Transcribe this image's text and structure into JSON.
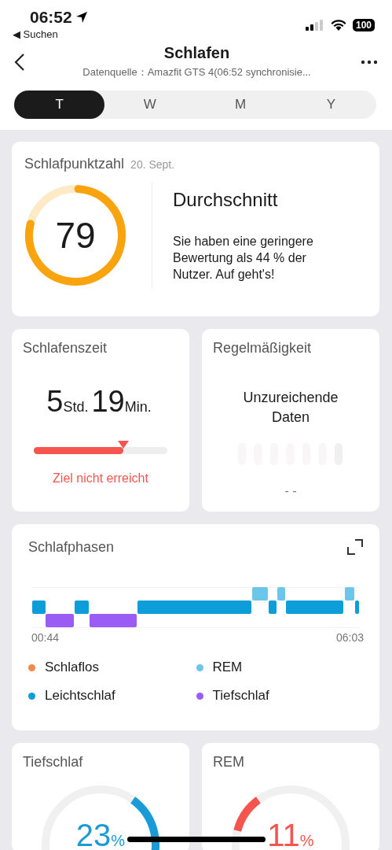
{
  "status_bar": {
    "time": "06:52",
    "back_link": "◀ Suchen",
    "battery": "100"
  },
  "header": {
    "title": "Schlafen",
    "subtitle": "Datenquelle：Amazfit GTS 4(06:52 synchronisie..."
  },
  "tabs": [
    {
      "label": "T",
      "selected": true
    },
    {
      "label": "W",
      "selected": false
    },
    {
      "label": "M",
      "selected": false
    },
    {
      "label": "Y",
      "selected": false
    }
  ],
  "score_card": {
    "title": "Schlafpunktzahl",
    "date": "20. Sept.",
    "score": "79",
    "rating": "Durchschnitt",
    "message": "Sie haben eine geringere Bewertung als 44 % der Nutzer. Auf geht's!"
  },
  "duration_card": {
    "title": "Schlafenszeit",
    "hours": "5",
    "hours_unit": "Std.",
    "minutes": "19",
    "minutes_unit": "Min.",
    "level": 0.67,
    "status": "Ziel nicht erreicht"
  },
  "regularity_card": {
    "title": "Regelmäßigkeit",
    "message": "Unzureichende Daten",
    "value": "- -"
  },
  "phases_card": {
    "title": "Schlafphasen",
    "start_time": "00:44",
    "end_time": "06:03",
    "legend": [
      {
        "label": "Schlaflos",
        "color": "#f5894a"
      },
      {
        "label": "REM",
        "color": "#6cc6ea"
      },
      {
        "label": "Leichtschlaf",
        "color": "#0d9ed9"
      },
      {
        "label": "Tiefschlaf",
        "color": "#9a5cf5"
      }
    ]
  },
  "bottom_cards": [
    {
      "title": "Tiefschlaf",
      "value": "23",
      "unit": "%",
      "color": "#1a9bd8"
    },
    {
      "title": "REM",
      "value": "11",
      "unit": "%",
      "color": "#f5554d"
    }
  ]
}
